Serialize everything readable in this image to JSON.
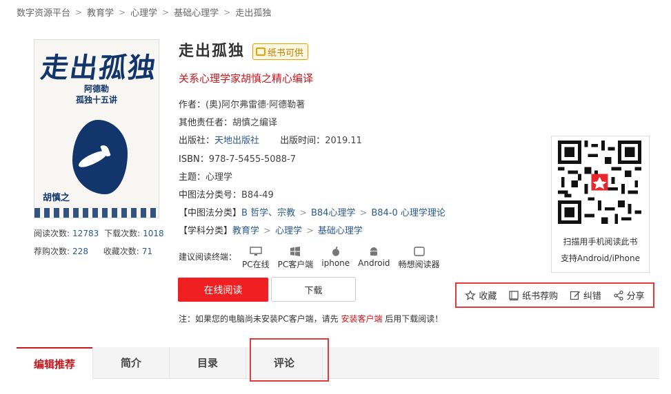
{
  "breadcrumb": [
    "数字资源平台",
    "教育学",
    "心理学",
    "基础心理学",
    "走出孤独"
  ],
  "cover": {
    "title": "走出孤独",
    "sub1": "阿德勒",
    "sub2": "孤独十五讲",
    "author": "胡慎之"
  },
  "stats": {
    "read_label": "阅读次数:",
    "read_value": "12783",
    "download_label": "下载次数:",
    "download_value": "1018",
    "recommend_label": "荐购次数:",
    "recommend_value": "228",
    "favorite_label": "收藏次数:",
    "favorite_value": "71"
  },
  "book": {
    "title": "走出孤独",
    "badge": "纸书可供",
    "subtitle": "关系心理学家胡慎之精心编译",
    "author_label": "作者：",
    "author": "(奥)阿尔弗雷德·阿德勒著",
    "editor_label": "其他责任者：",
    "editor": "胡慎之编译",
    "publisher_label": "出版社：",
    "publisher": "天地出版社",
    "pubdate_label": "出版时间：",
    "pubdate": "2019.11",
    "isbn_label": "ISBN：",
    "isbn": "978-7-5455-5088-7",
    "subject_label": "主题：",
    "subject": "心理学",
    "clc_label": "中图法分类号：",
    "clc": "B84-49"
  },
  "clc_path": {
    "label": "【中图法分类】",
    "items": [
      "B 哲学、宗教",
      "B84心理学",
      "B84-0 心理学理论"
    ]
  },
  "subject_path": {
    "label": "【学科分类】",
    "items": [
      "教育学",
      "心理学",
      "基础心理学"
    ]
  },
  "devices": {
    "label": "建议阅读终端：",
    "items": [
      {
        "name": "PC在线",
        "icon": "monitor-icon"
      },
      {
        "name": "PC客户端",
        "icon": "windows-icon"
      },
      {
        "name": "iphone",
        "icon": "apple-icon"
      },
      {
        "name": "Android",
        "icon": "android-icon"
      },
      {
        "name": "畅想阅读器",
        "icon": "tablet-icon"
      }
    ]
  },
  "buttons": {
    "read": "在线阅读",
    "download": "下载"
  },
  "note": {
    "prefix": "注：如果您的电脑尚未安装PC客户端，请先",
    "link": "安装客户端",
    "suffix": "后用下载阅读！"
  },
  "qr": {
    "line1": "扫描用手机阅读此书",
    "line2": "支持Android/iPhone"
  },
  "actions": [
    {
      "label": "收藏",
      "icon": "star-icon"
    },
    {
      "label": "纸书荐购",
      "icon": "book-icon"
    },
    {
      "label": "纠错",
      "icon": "edit-icon"
    },
    {
      "label": "分享",
      "icon": "share-icon"
    }
  ],
  "tabs": [
    "编辑推荐",
    "简介",
    "目录",
    "评论"
  ],
  "colors": {
    "accent": "#c9161d",
    "button": "#f01f22",
    "link": "#2b5a8f",
    "highlight": "#e03a3a"
  }
}
